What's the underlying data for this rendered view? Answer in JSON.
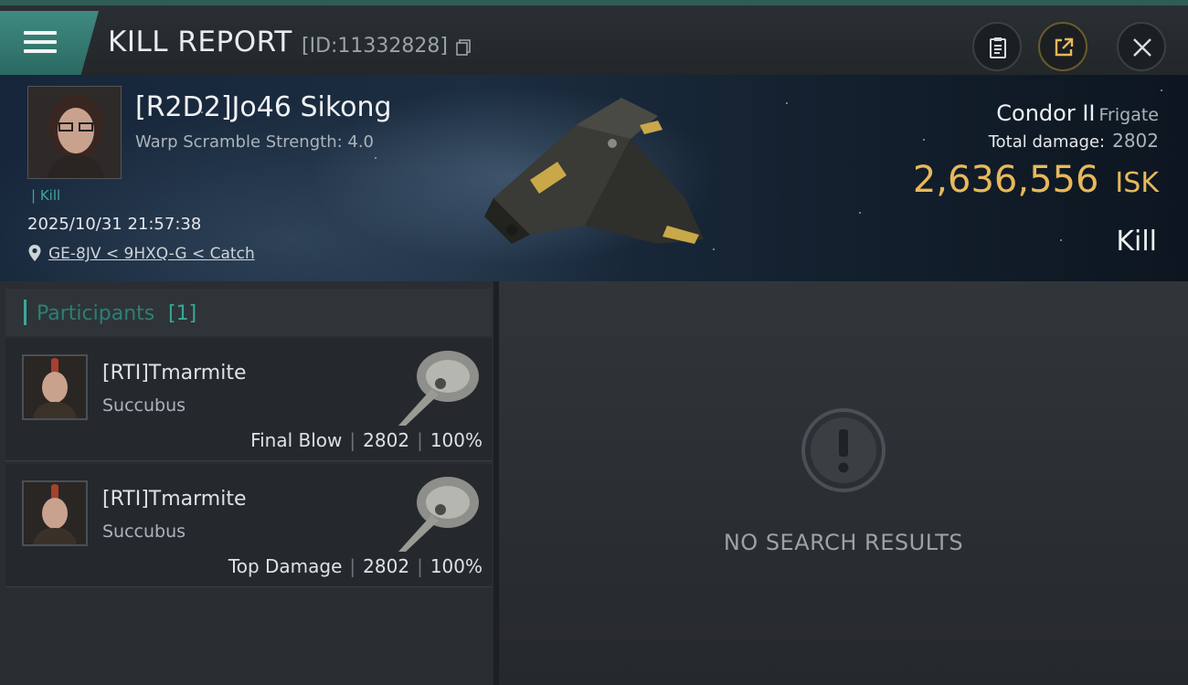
{
  "header": {
    "title": "KILL REPORT",
    "report_id": "[ID:11332828]"
  },
  "victim": {
    "name": "[R2D2]Jo46 Sikong",
    "scram_strength": "Warp Scramble Strength: 4.0",
    "kill_tag": "Kill",
    "timestamp": "2025/10/31 21:57:38",
    "location": "GE-8JV < 9HXQ-G < Catch"
  },
  "ship": {
    "name": "Condor II",
    "class": "Frigate",
    "total_damage_label": "Total damage:",
    "total_damage": "2802",
    "isk_value": "2,636,556",
    "isk_unit": "ISK",
    "result": "Kill"
  },
  "participants": {
    "title": "Participants",
    "count": "[1]",
    "rows": [
      {
        "name": "[RTI]Tmarmite",
        "ship": "Succubus",
        "role": "Final Blow",
        "damage": "2802",
        "percent": "100%"
      },
      {
        "name": "[RTI]Tmarmite",
        "ship": "Succubus",
        "role": "Top Damage",
        "damage": "2802",
        "percent": "100%"
      }
    ]
  },
  "results": {
    "empty_text": "NO SEARCH RESULTS"
  },
  "colors": {
    "accent": "#3aa89a",
    "isk": "#e8b85a"
  }
}
